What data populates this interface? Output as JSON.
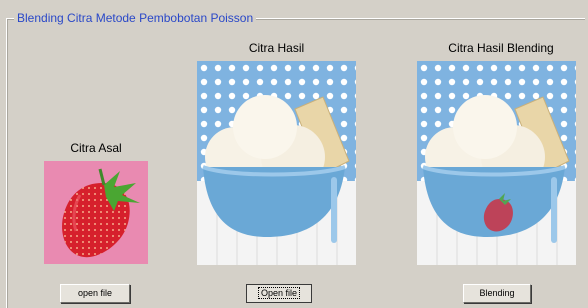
{
  "group": {
    "title": "Blending Citra Metode Pembobotan Poisson"
  },
  "panels": {
    "source": {
      "caption": "Citra Asal",
      "button": "open file"
    },
    "result": {
      "caption": "Citra Hasil",
      "button": "Open file"
    },
    "blended": {
      "caption": "Citra Hasil Blending",
      "button": "Blending"
    }
  }
}
